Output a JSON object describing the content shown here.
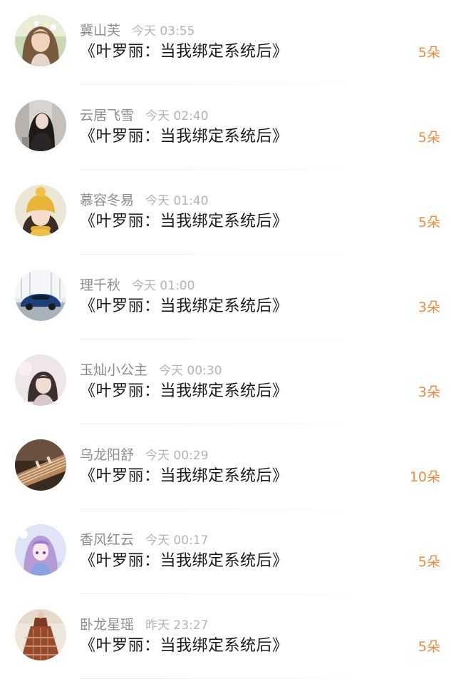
{
  "entries": [
    {
      "name": "冀山芙",
      "time": "今天 03:55",
      "title": "《叶罗丽：当我绑定系统后》",
      "count": "5朵",
      "avatar_icon": "girl-floral-portrait"
    },
    {
      "name": "云居飞雪",
      "time": "今天 02:40",
      "title": "《叶罗丽：当我绑定系统后》",
      "count": "5朵",
      "avatar_icon": "girl-dark-portrait"
    },
    {
      "name": "慕容冬易",
      "time": "今天 01:40",
      "title": "《叶罗丽：当我绑定系统后》",
      "count": "5朵",
      "avatar_icon": "girl-yellow-beanie"
    },
    {
      "name": "理千秋",
      "time": "今天 01:00",
      "title": "《叶罗丽：当我绑定系统后》",
      "count": "3朵",
      "avatar_icon": "blue-sports-car"
    },
    {
      "name": "玉灿小公主",
      "time": "今天 00:30",
      "title": "《叶罗丽：当我绑定系统后》",
      "count": "3朵",
      "avatar_icon": "girl-soft-portrait"
    },
    {
      "name": "乌龙阳舒",
      "time": "今天 00:29",
      "title": "《叶罗丽：当我绑定系统后》",
      "count": "10朵",
      "avatar_icon": "guzheng-instrument"
    },
    {
      "name": "香风红云",
      "time": "今天 00:17",
      "title": "《叶罗丽：当我绑定系统后》",
      "count": "5朵",
      "avatar_icon": "anime-purple-girl"
    },
    {
      "name": "卧龙星瑶",
      "time": "昨天 23:27",
      "title": "《叶罗丽：当我绑定系统后》",
      "count": "5朵",
      "avatar_icon": "vintage-dress"
    }
  ],
  "colors": {
    "name": "#8c8c8c",
    "time": "#b4b4b4",
    "title": "#1a1a1a",
    "count": "#f08a3c"
  }
}
